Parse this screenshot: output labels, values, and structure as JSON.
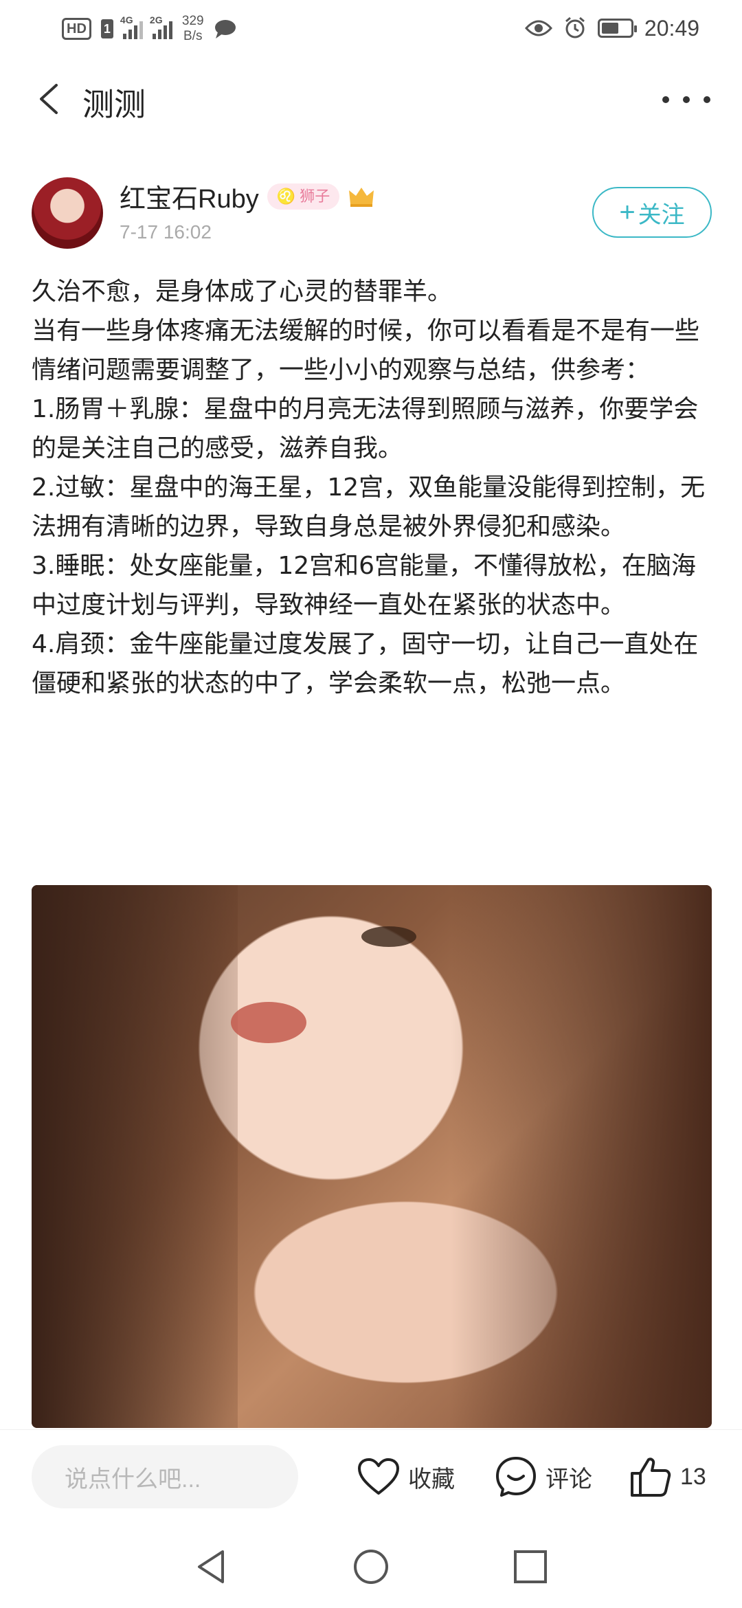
{
  "status_bar": {
    "hd": "HD",
    "sim": "1",
    "sig1_label": "4G",
    "sig2_label": "2G",
    "speed_value": "329",
    "speed_unit": "B/s",
    "time": "20:49"
  },
  "nav": {
    "title": "测测"
  },
  "post": {
    "author_name": "红宝石Ruby",
    "zodiac_badge": "♌ 狮子",
    "time": "7-17 16:02",
    "follow_label": "关注",
    "follow_plus": "+",
    "paragraphs": [
      "久治不愈，是身体成了心灵的替罪羊。",
      "当有一些身体疼痛无法缓解的时候，你可以看看是不是有一些情绪问题需要调整了，一些小小的观察与总结，供参考：",
      "1.肠胃＋乳腺：星盘中的月亮无法得到照顾与滋养，你要学会的是关注自己的感受，滋养自我。",
      "2.过敏：星盘中的海王星，12宫，双鱼能量没能得到控制，无法拥有清晰的边界，导致自身总是被外界侵犯和感染。",
      "3.睡眠：处女座能量，12宫和6宫能量，不懂得放松，在脑海中过度计划与评判，导致神经一直处在紧张的状态中。",
      "4.肩颈：金牛座能量过度发展了，固守一切，让自己一直处在僵硬和紧张的状态的中了，学会柔软一点，松弛一点。"
    ]
  },
  "action_bar": {
    "comment_placeholder": "说点什么吧...",
    "collect_label": "收藏",
    "comment_label": "评论",
    "like_count": "13"
  }
}
